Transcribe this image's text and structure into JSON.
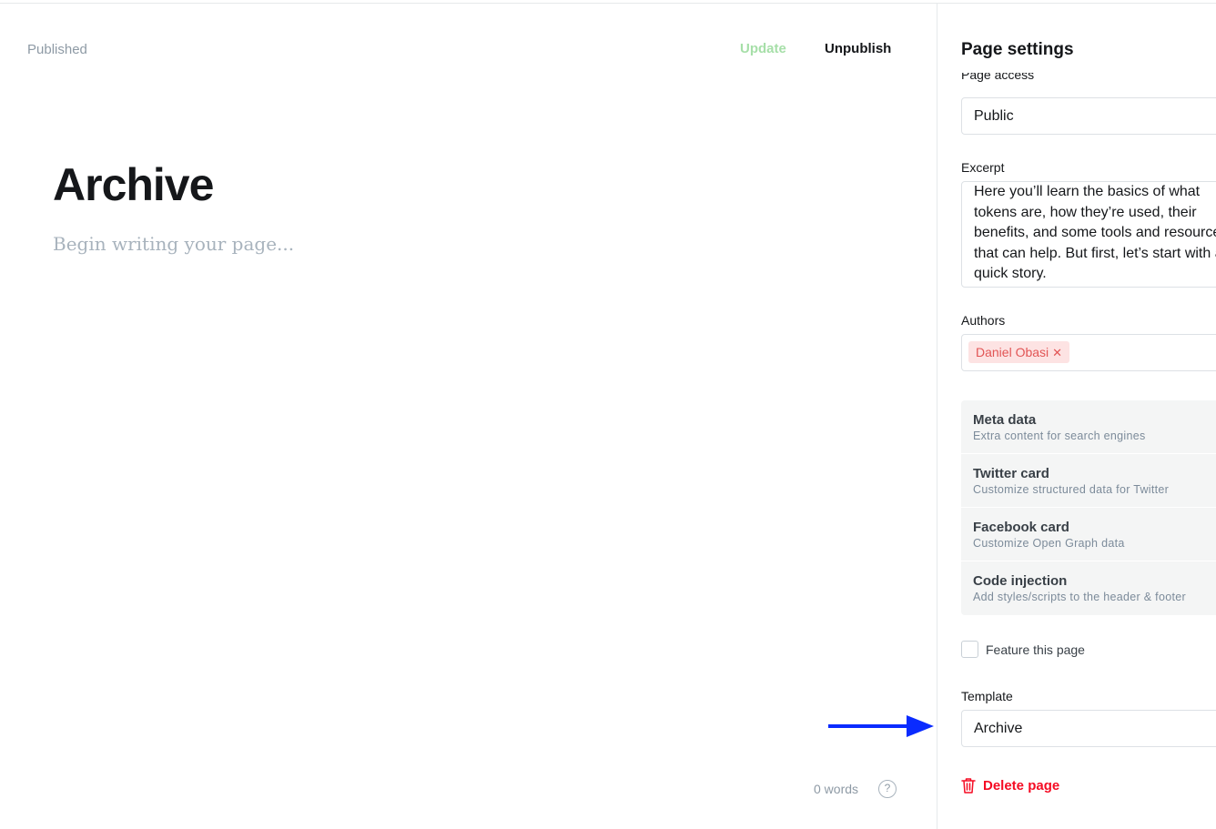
{
  "editor": {
    "status": "Published",
    "update_label": "Update",
    "unpublish_label": "Unpublish",
    "title": "Archive",
    "body_placeholder": "Begin writing your page...",
    "word_count": "0 words",
    "help_glyph": "?"
  },
  "settings": {
    "title": "Page settings",
    "access_label": "Page access",
    "access_value": "Public",
    "excerpt_label": "Excerpt",
    "excerpt_value": "Here you’ll learn the basics of what tokens are, how they’re used, their benefits, and some tools and resources that can help. But first, let’s start with a quick story.",
    "authors_label": "Authors",
    "author_tag": "Daniel Obasi",
    "author_remove_glyph": "✕",
    "menu": [
      {
        "title": "Meta data",
        "subtitle": "Extra content for search engines"
      },
      {
        "title": "Twitter card",
        "subtitle": "Customize structured data for Twitter"
      },
      {
        "title": "Facebook card",
        "subtitle": "Customize Open Graph data"
      },
      {
        "title": "Code injection",
        "subtitle": "Add styles/scripts to the header & footer"
      }
    ],
    "feature_label": "Feature this page",
    "feature_checked": false,
    "template_label": "Template",
    "template_value": "Archive",
    "delete_label": "Delete page"
  },
  "icons": {
    "delete": "trash-icon",
    "help": "question-circle-icon",
    "remove": "close-icon",
    "pointer": "arrow-right-icon"
  },
  "colors": {
    "accent_green": "#a6dfa8",
    "danger_red": "#f50b23",
    "tag_bg": "#fde3e3",
    "annotation_arrow": "#0a2bff"
  }
}
